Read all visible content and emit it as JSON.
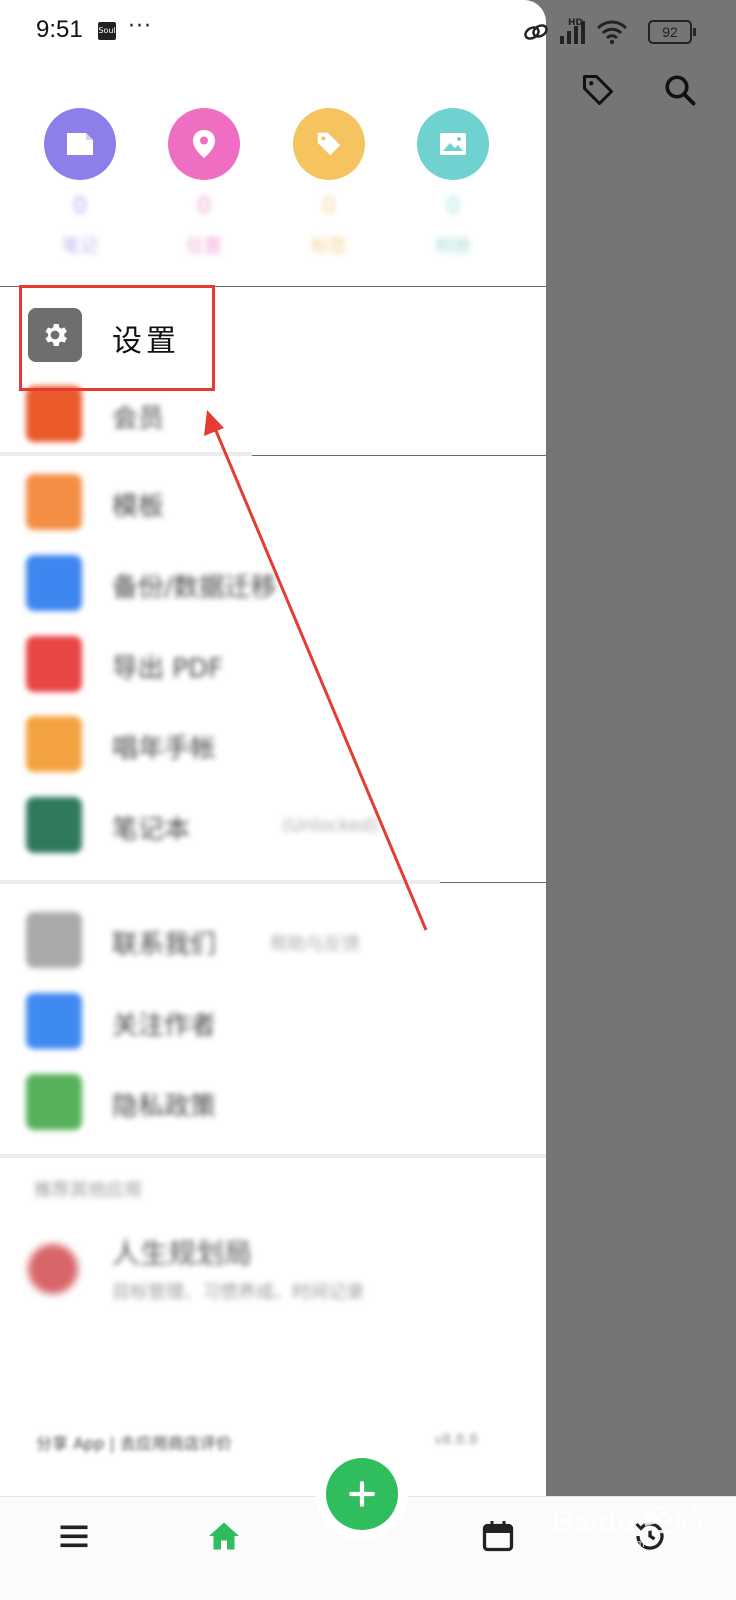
{
  "status_bar": {
    "time": "9:51",
    "app_icon_text": "Soul",
    "more": "···",
    "network": "HD",
    "battery": "92"
  },
  "quick_categories": [
    {
      "icon": "note-icon",
      "color": "#8d7fe8",
      "count": "0",
      "label": "笔记"
    },
    {
      "icon": "location-icon",
      "color": "#ef6ec2",
      "count": "0",
      "label": "位置"
    },
    {
      "icon": "tag-icon",
      "color": "#f6c45f",
      "count": "0",
      "label": "标签"
    },
    {
      "icon": "image-icon",
      "color": "#6fd2d0",
      "count": "0",
      "label": "相册"
    }
  ],
  "settings_item": {
    "icon": "gear-icon",
    "label": "设置"
  },
  "menu_group_1": [
    {
      "icon": "member-icon",
      "color": "#ea5a2b",
      "label": "会员"
    }
  ],
  "menu_group_2": [
    {
      "icon": "template-icon",
      "color": "#f48e45",
      "label": "模板"
    },
    {
      "icon": "backup-icon",
      "color": "#3e86f0",
      "label": "备份/数据迁移"
    },
    {
      "icon": "pdf-icon",
      "color": "#e84545",
      "label": "导出 PDF"
    },
    {
      "icon": "calendar-note-icon",
      "color": "#f3a241",
      "label": "唱年手帐"
    },
    {
      "icon": "notebook-icon",
      "color": "#2f7a5c",
      "label": "笔记本",
      "sub": "(Unlocked)"
    }
  ],
  "menu_group_3": [
    {
      "icon": "contact-icon",
      "color": "#a9a9a9",
      "label": "联系我们",
      "sub": "帮助与反馈"
    },
    {
      "icon": "follow-icon",
      "color": "#3f8af0",
      "label": "关注作者"
    },
    {
      "icon": "privacy-icon",
      "color": "#56b15a",
      "label": "隐私政策"
    }
  ],
  "section_title": "推荐其他应用",
  "promo": {
    "title": "人生规划局",
    "desc": "目标管理、习惯养成、时间记录"
  },
  "footer": {
    "left": "分享 App | 去应用商店评价",
    "right": "v8.8.8"
  },
  "bottom_nav": {
    "menu": "menu-icon",
    "home": "home-icon",
    "add": "plus-icon",
    "calendar": "calendar-icon",
    "history": "history-icon"
  },
  "watermark": {
    "brand": "Baidu 经验",
    "url": "jingyan.baidu.com"
  },
  "colors": {
    "overlay": "#757575",
    "fab": "#2fbd5e",
    "highlight": "#e63b33",
    "arrow": "#e63b33"
  }
}
